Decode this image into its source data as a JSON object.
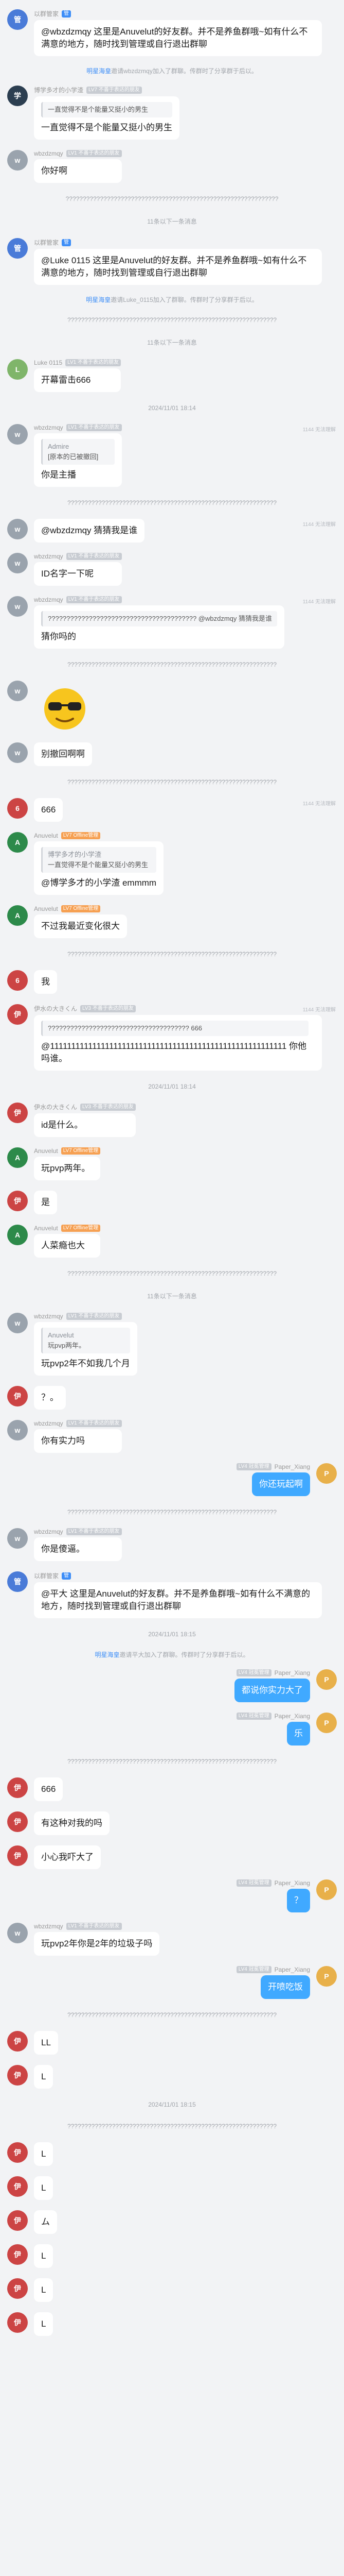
{
  "items": [
    {
      "t": "msg",
      "side": "left",
      "name": "以群管家",
      "badges": [
        {
          "text": "管",
          "style": "blue"
        }
      ],
      "avatar": {
        "color": "#4a7bd8",
        "text": "管"
      },
      "text": "@wbzdzmqy 这里是Anuvelut的好友群。并不是养鱼群哦~如有什么不满意的地方，随时找到管理或自行退出群聊"
    },
    {
      "t": "sys",
      "who": "明星海皇",
      "rest": "邀请wbzdzmqy加入了群聊。传群时了分享群于后以。"
    },
    {
      "t": "msg",
      "side": "left",
      "name": "博学多才的小学渣",
      "badges": [
        {
          "text": "LV7 不善于表达的朋友",
          "style": "gray"
        }
      ],
      "avatar": {
        "color": "#2c3e50",
        "text": "学"
      },
      "quote": {
        "name": "",
        "text": "一直觉得不是个能量又挺小的男生"
      },
      "text": "一直觉得不是个能量又挺小的男生"
    },
    {
      "t": "msg",
      "side": "left",
      "name": "wbzdzmqy",
      "badges": [
        {
          "text": "LV1 不善于表达的朋友",
          "style": "gray"
        }
      ],
      "avatar": {
        "color": "#9aa3ad",
        "text": "w"
      },
      "text": "你好啊"
    },
    {
      "t": "sep",
      "text": "??????????????????????????????????????????????????????????????"
    },
    {
      "t": "sep",
      "text": "11条以下一条消息"
    },
    {
      "t": "msg",
      "side": "left",
      "name": "以群管家",
      "badges": [
        {
          "text": "管",
          "style": "blue"
        }
      ],
      "avatar": {
        "color": "#4a7bd8",
        "text": "管"
      },
      "text": "@Luke 0115 这里是Anuvelut的好友群。并不是养鱼群哦~如有什么不满意的地方，随时找到管理或自行退出群聊"
    },
    {
      "t": "sys",
      "who": "明星海皇",
      "rest": "邀请Luke_0115加入了群聊。传群时了分享群于后以。"
    },
    {
      "t": "sep",
      "text": "?????????????????????????????????????????????????????????????"
    },
    {
      "t": "sep",
      "text": "11条以下一条消息"
    },
    {
      "t": "msg",
      "side": "left",
      "name": "Luke 0115",
      "badges": [
        {
          "text": "LV1 不善于表达的朋友",
          "style": "gray"
        }
      ],
      "avatar": {
        "color": "#7fb56a",
        "text": "L"
      },
      "text": "开幕雷击666"
    },
    {
      "t": "time",
      "text": "2024/11/01 18:14"
    },
    {
      "t": "msg",
      "side": "left",
      "name": "wbzdzmqy",
      "badges": [
        {
          "text": "LV1 不善于表达的朋友",
          "style": "gray"
        }
      ],
      "avatar": {
        "color": "#9aa3ad",
        "text": "w"
      },
      "quote": {
        "name": "Admire",
        "text": "[原本的已被撤回]"
      },
      "text": "你是主播",
      "tag": "1144 无法理解"
    },
    {
      "t": "sep",
      "text": "?????????????????????????????????????????????????????????????"
    },
    {
      "t": "msg",
      "side": "left",
      "name": "",
      "badges": [],
      "avatar": {
        "color": "#9aa3ad",
        "text": "w"
      },
      "text": "@wbzdzmqy 猜猜我是谁",
      "tag": "1144 无法理解"
    },
    {
      "t": "msg",
      "side": "left",
      "name": "wbzdzmqy",
      "badges": [
        {
          "text": "LV1 不善于表达的朋友",
          "style": "gray"
        }
      ],
      "avatar": {
        "color": "#9aa3ad",
        "text": "w"
      },
      "text": "ID名字一下呢"
    },
    {
      "t": "msg",
      "side": "left",
      "name": "wbzdzmqy",
      "badges": [
        {
          "text": "LV1 不善于表达的朋友",
          "style": "gray"
        }
      ],
      "avatar": {
        "color": "#9aa3ad",
        "text": "w"
      },
      "quote": {
        "name": "",
        "text": "???????????????????????????????????????? @wbzdzmqy 猜猜我是谁"
      },
      "text": "猜你吗的",
      "tag": "1144 无法理解"
    },
    {
      "t": "sep",
      "text": "?????????????????????????????????????????????????????????????"
    },
    {
      "t": "sticker",
      "side": "left",
      "name": "",
      "badges": [],
      "avatar": {
        "color": "#9aa3ad",
        "text": "w"
      }
    },
    {
      "t": "msg",
      "side": "left",
      "name": "",
      "badges": [],
      "avatar": {
        "color": "#9aa3ad",
        "text": "w"
      },
      "text": "别撤回啊啊"
    },
    {
      "t": "sep",
      "text": "?????????????????????????????????????????????????????????????"
    },
    {
      "t": "msg",
      "side": "left",
      "name": "",
      "badges": [],
      "avatar": {
        "color": "#c44",
        "text": "6"
      },
      "text": "666",
      "tag": "1144 无法理解"
    },
    {
      "t": "msg",
      "side": "left",
      "name": "Anuvelut",
      "badges": [
        {
          "text": "LV7 Offline管理",
          "style": "orange"
        }
      ],
      "avatar": {
        "color": "#2d8a4a",
        "text": "A"
      },
      "quote": {
        "name": "博学多才的小学渣",
        "text": "一直觉得不是个能量又挺小的男生"
      },
      "text": "@博学多才的小学渣 emmmm"
    },
    {
      "t": "msg",
      "side": "left",
      "name": "Anuvelut",
      "badges": [
        {
          "text": "LV7 Offline管理",
          "style": "orange"
        }
      ],
      "avatar": {
        "color": "#2d8a4a",
        "text": "A"
      },
      "text": "不过我最近变化很大"
    },
    {
      "t": "sep",
      "text": "?????????????????????????????????????????????????????????????"
    },
    {
      "t": "msg",
      "side": "left",
      "name": "",
      "badges": [],
      "avatar": {
        "color": "#c44",
        "text": "6"
      },
      "text": "我"
    },
    {
      "t": "msg",
      "side": "left",
      "name": "伊水の大きくん",
      "badges": [
        {
          "text": "LV3 不善于表达的朋友",
          "style": "gray"
        }
      ],
      "avatar": {
        "color": "#c44",
        "text": "伊"
      },
      "quote": {
        "name": "",
        "text": "?????????????????????????????????????? 666"
      },
      "text": "@11111111111111111111111111111111111111111111111111111111 你他吗谁。",
      "tag": "1144 无法理解"
    },
    {
      "t": "time",
      "text": "2024/11/01 18:14"
    },
    {
      "t": "msg",
      "side": "left",
      "name": "伊水の大きくん",
      "badges": [
        {
          "text": "LV3 不善于表达的朋友",
          "style": "gray"
        }
      ],
      "avatar": {
        "color": "#c44",
        "text": "伊"
      },
      "text": "id是什么。"
    },
    {
      "t": "msg",
      "side": "left",
      "name": "Anuvelut",
      "badges": [
        {
          "text": "LV7 Offline管理",
          "style": "orange"
        }
      ],
      "avatar": {
        "color": "#2d8a4a",
        "text": "A"
      },
      "text": "玩pvp两年。"
    },
    {
      "t": "msg",
      "side": "left",
      "name": "",
      "badges": [],
      "avatar": {
        "color": "#c44",
        "text": "伊"
      },
      "text": "是"
    },
    {
      "t": "msg",
      "side": "left",
      "name": "Anuvelut",
      "badges": [
        {
          "text": "LV7 Offline管理",
          "style": "orange"
        }
      ],
      "avatar": {
        "color": "#2d8a4a",
        "text": "A"
      },
      "text": "人菜瘾也大"
    },
    {
      "t": "sep",
      "text": "?????????????????????????????????????????????????????????????"
    },
    {
      "t": "sep",
      "text": "11条以下一条消息"
    },
    {
      "t": "msg",
      "side": "left",
      "name": "wbzdzmqy",
      "badges": [
        {
          "text": "LV1 不善于表达的朋友",
          "style": "gray"
        }
      ],
      "avatar": {
        "color": "#9aa3ad",
        "text": "w"
      },
      "quote": {
        "name": "Anuvelut",
        "text": "玩pvp两年。"
      },
      "text": "玩pvp2年不如我几个月"
    },
    {
      "t": "msg",
      "side": "left",
      "name": "",
      "badges": [],
      "avatar": {
        "color": "#c44",
        "text": "伊"
      },
      "text": "？。"
    },
    {
      "t": "msg",
      "side": "left",
      "name": "wbzdzmqy",
      "badges": [
        {
          "text": "LV1 不善于表达的朋友",
          "style": "gray"
        }
      ],
      "avatar": {
        "color": "#9aa3ad",
        "text": "w"
      },
      "text": "你有实力吗"
    },
    {
      "t": "msg",
      "side": "right",
      "name": "Paper_Xiang",
      "badges": [
        {
          "text": "LV4 冠冕管理",
          "style": "gray"
        }
      ],
      "avatar": {
        "color": "#e8b04a",
        "text": "P"
      },
      "text": "你还玩起啊"
    },
    {
      "t": "sep",
      "text": "?????????????????????????????????????????????????????????????"
    },
    {
      "t": "msg",
      "side": "left",
      "name": "wbzdzmqy",
      "badges": [
        {
          "text": "LV1 不善于表达的朋友",
          "style": "gray"
        }
      ],
      "avatar": {
        "color": "#9aa3ad",
        "text": "w"
      },
      "text": "你是傻逼。"
    },
    {
      "t": "msg",
      "side": "left",
      "name": "以群管家",
      "badges": [
        {
          "text": "管",
          "style": "blue"
        }
      ],
      "avatar": {
        "color": "#4a7bd8",
        "text": "管"
      },
      "text": "@平大 这里是Anuvelut的好友群。并不是养鱼群哦~如有什么不满意的地方，随时找到管理或自行退出群聊"
    },
    {
      "t": "time",
      "text": "2024/11/01 18:15"
    },
    {
      "t": "sys",
      "who": "明星海皇",
      "rest": "邀请平大加入了群聊。传群时了分享群于后以。"
    },
    {
      "t": "msg",
      "side": "right",
      "name": "Paper_Xiang",
      "badges": [
        {
          "text": "LV4 冠冕管理",
          "style": "gray"
        }
      ],
      "avatar": {
        "color": "#e8b04a",
        "text": "P"
      },
      "text": "都说你实力大了"
    },
    {
      "t": "msg",
      "side": "right",
      "name": "Paper_Xiang",
      "badges": [
        {
          "text": "LV4 冠冕管理",
          "style": "gray"
        }
      ],
      "avatar": {
        "color": "#e8b04a",
        "text": "P"
      },
      "text": "乐"
    },
    {
      "t": "sep",
      "text": "?????????????????????????????????????????????????????????????"
    },
    {
      "t": "msg",
      "side": "left",
      "name": "",
      "badges": [],
      "avatar": {
        "color": "#c44",
        "text": "伊"
      },
      "text": "666"
    },
    {
      "t": "msg",
      "side": "left",
      "name": "",
      "badges": [],
      "avatar": {
        "color": "#c44",
        "text": "伊"
      },
      "text": "有这种对我的吗"
    },
    {
      "t": "msg",
      "side": "left",
      "name": "",
      "badges": [],
      "avatar": {
        "color": "#c44",
        "text": "伊"
      },
      "text": "小心我吓大了"
    },
    {
      "t": "msg",
      "side": "right",
      "name": "Paper_Xiang",
      "badges": [
        {
          "text": "LV4 冠冕管理",
          "style": "gray"
        }
      ],
      "avatar": {
        "color": "#e8b04a",
        "text": "P"
      },
      "text": "？"
    },
    {
      "t": "msg",
      "side": "left",
      "name": "wbzdzmqy",
      "badges": [
        {
          "text": "LV1 不善于表达的朋友",
          "style": "gray"
        }
      ],
      "avatar": {
        "color": "#9aa3ad",
        "text": "w"
      },
      "text": "玩pvp2年你是2年的垃圾子吗"
    },
    {
      "t": "msg",
      "side": "right",
      "name": "Paper_Xiang",
      "badges": [
        {
          "text": "LV4 冠冕管理",
          "style": "gray"
        }
      ],
      "avatar": {
        "color": "#e8b04a",
        "text": "P"
      },
      "text": "开喷吃饭"
    },
    {
      "t": "sep",
      "text": "?????????????????????????????????????????????????????????????"
    },
    {
      "t": "msg",
      "side": "left",
      "name": "",
      "badges": [],
      "avatar": {
        "color": "#c44",
        "text": "伊"
      },
      "text": "LL"
    },
    {
      "t": "msg",
      "side": "left",
      "name": "",
      "badges": [],
      "avatar": {
        "color": "#c44",
        "text": "伊"
      },
      "text": "L"
    },
    {
      "t": "time",
      "text": "2024/11/01 18:15"
    },
    {
      "t": "sep",
      "text": "?????????????????????????????????????????????????????????????"
    },
    {
      "t": "msg",
      "side": "left",
      "name": "",
      "badges": [],
      "avatar": {
        "color": "#c44",
        "text": "伊"
      },
      "text": "L"
    },
    {
      "t": "msg",
      "side": "left",
      "name": "",
      "badges": [],
      "avatar": {
        "color": "#c44",
        "text": "伊"
      },
      "text": "L"
    },
    {
      "t": "msg",
      "side": "left",
      "name": "",
      "badges": [],
      "avatar": {
        "color": "#c44",
        "text": "伊"
      },
      "text": "ム"
    },
    {
      "t": "msg",
      "side": "left",
      "name": "",
      "badges": [],
      "avatar": {
        "color": "#c44",
        "text": "伊"
      },
      "text": "L"
    },
    {
      "t": "msg",
      "side": "left",
      "name": "",
      "badges": [],
      "avatar": {
        "color": "#c44",
        "text": "伊"
      },
      "text": "L"
    },
    {
      "t": "msg",
      "side": "left",
      "name": "",
      "badges": [],
      "avatar": {
        "color": "#c44",
        "text": "伊"
      },
      "text": "L"
    }
  ]
}
